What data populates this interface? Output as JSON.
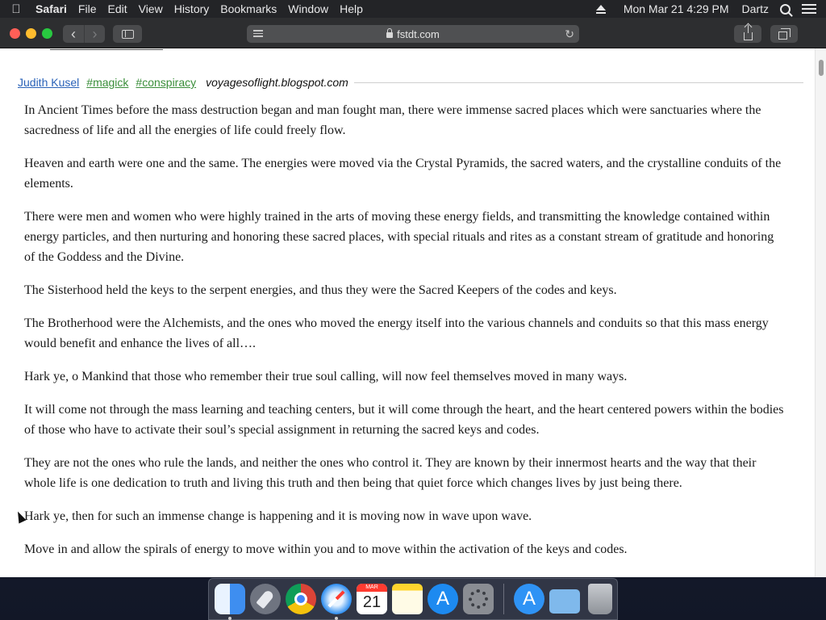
{
  "menubar": {
    "app": "Safari",
    "items": [
      "File",
      "Edit",
      "View",
      "History",
      "Bookmarks",
      "Window",
      "Help"
    ],
    "datetime": "Mon Mar 21  4:29 PM",
    "user": "Dartz"
  },
  "browser": {
    "url": "fstdt.com",
    "back_symbol": "‹",
    "forward_symbol": "›",
    "reload_symbol": "↻",
    "new_tab_symbol": "+"
  },
  "post": {
    "author": "Judith Kusel",
    "tags": [
      "#magick",
      "#conspiracy"
    ],
    "source": "voyagesoflight.blogspot.com",
    "paragraphs": [
      "In Ancient Times before the mass destruction began and man fought man, there were immense sacred places which were sanctuaries where the sacredness of life and all the energies of life could freely flow.",
      "Heaven and earth were one and the same. The energies were moved via the Crystal Pyramids, the sacred waters, and the crystalline conduits of the elements.",
      "There were men and women who were highly trained in the arts of moving these energy fields, and transmitting the knowledge contained within energy particles, and then nurturing and honoring these sacred places, with special rituals and rites as a constant stream of gratitude and honoring of the Goddess and the Divine.",
      "The Sisterhood held the keys to the serpent energies, and thus they were the Sacred Keepers of the codes and keys.",
      "The Brotherhood were the Alchemists, and the ones who moved the energy itself into the various channels and conduits so that this mass energy would benefit and enhance the lives of all….",
      "Hark ye, o Mankind that those who remember their true soul calling, will now feel themselves moved in many ways.",
      "It will come not through the mass learning and teaching centers, but it will come through the heart, and the heart centered powers within the bodies of those who have to activate their soul’s special assignment in returning the sacred keys and codes.",
      "They are not the ones who rule the lands, and neither the ones who control it. They are known by their innermost hearts and the way that their whole life is one dedication to truth and living this truth and then being that quiet force which changes lives by just being there.",
      "Hark ye, then for such an immense change is happening and it is moving now in wave upon wave.",
      "Move in and allow the spirals of energy to move within you and to move within the activation of the keys and codes."
    ]
  },
  "dock": {
    "calendar_month": "MAR",
    "calendar_day": "21",
    "apps": [
      "finder-icon",
      "launchpad-icon",
      "chrome-icon",
      "safari-icon",
      "calendar-icon",
      "notes-icon",
      "app-store-icon",
      "system-preferences-icon",
      "applications-folder-icon",
      "downloads-folder-icon",
      "trash-icon"
    ]
  }
}
